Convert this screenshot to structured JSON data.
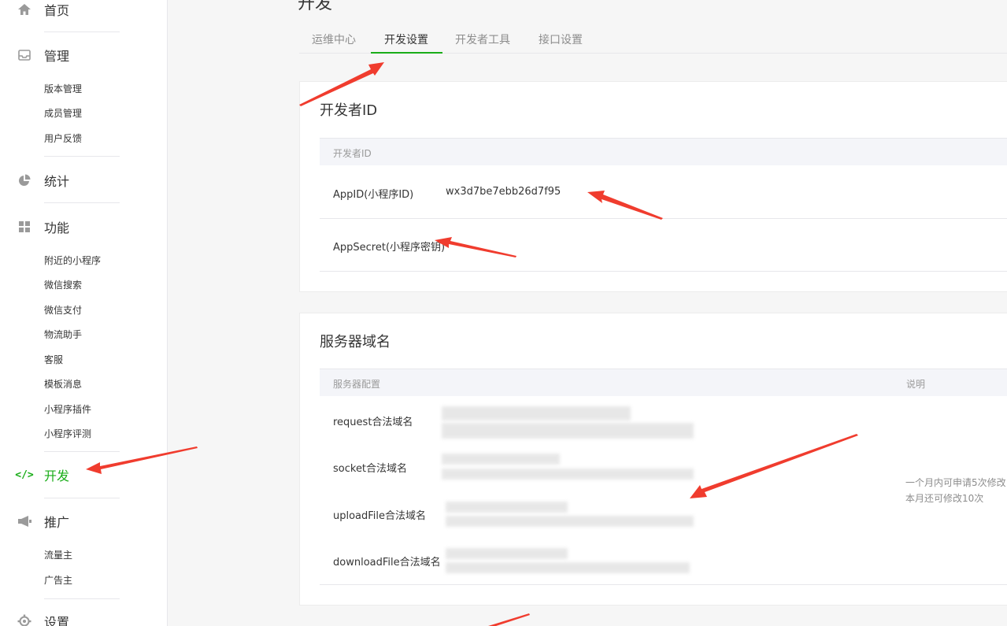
{
  "sidebar": {
    "home": {
      "label": "首页",
      "icon": "home-icon"
    },
    "manage": {
      "label": "管理",
      "icon": "inbox-icon",
      "items": [
        "版本管理",
        "成员管理",
        "用户反馈"
      ]
    },
    "stats": {
      "label": "统计",
      "icon": "pie-chart-icon"
    },
    "features": {
      "label": "功能",
      "icon": "grid-icon",
      "items": [
        "附近的小程序",
        "微信搜索",
        "微信支付",
        "物流助手",
        "客服",
        "模板消息",
        "小程序插件",
        "小程序评测"
      ]
    },
    "dev": {
      "label": "开发",
      "icon": "code-icon",
      "active": true
    },
    "promote": {
      "label": "推广",
      "icon": "megaphone-icon",
      "items": [
        "流量主",
        "广告主"
      ]
    },
    "settings": {
      "label": "设置",
      "icon": "gear-icon"
    }
  },
  "page": {
    "title": "开发",
    "tabs": [
      "运维中心",
      "开发设置",
      "开发者工具",
      "接口设置"
    ],
    "active_tab": "开发设置"
  },
  "developer_id": {
    "title": "开发者ID",
    "header": "开发者ID",
    "appid_label": "AppID(小程序ID)",
    "appid_value": "wx3d7be7ebb26d7f95",
    "secret_label": "AppSecret(小程序密钥)"
  },
  "server_domain": {
    "title": "服务器域名",
    "header_config": "服务器配置",
    "header_desc": "说明",
    "rows": [
      "request合法域名",
      "socket合法域名",
      "uploadFile合法域名",
      "downloadFile合法域名"
    ],
    "note_line1": "一个月内可申请5次修改",
    "note_line2": "本月还可修改10次"
  },
  "colors": {
    "accent": "#1aad19",
    "annotation_arrow": "#f03c2e"
  }
}
